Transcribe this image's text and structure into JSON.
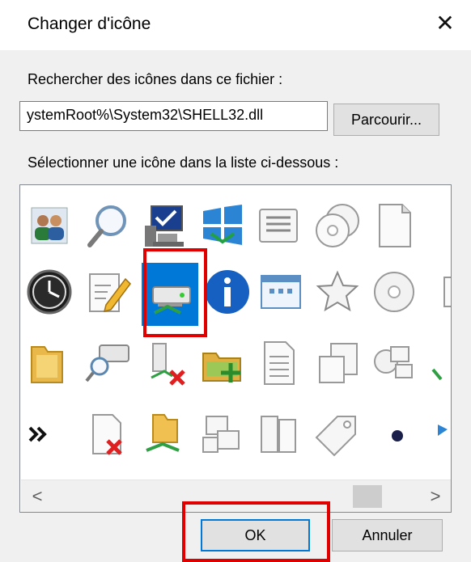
{
  "dialog": {
    "title": "Changer d'icône",
    "close_symbol": "✕"
  },
  "search": {
    "label": "Rechercher des icônes dans ce fichier :",
    "path_value": "ystemRoot%\\System32\\SHELL32.dll",
    "browse_label": "Parcourir..."
  },
  "list": {
    "label": "Sélectionner une icône dans la liste ci-dessous :",
    "icons": [
      "users-icon",
      "search-magnifier-icon",
      "computer-monitor-icon",
      "windows-logo-icon",
      "document-lines-icon",
      "disc-stack-icon",
      "blank-page-icon",
      "clock-icon",
      "notepad-pencil-icon",
      "drive-network-icon",
      "info-icon",
      "window-grid-icon",
      "star-icon",
      "cd-disc-icon",
      "folder-icon",
      "scanner-icon",
      "drive-error-icon",
      "folder-add-icon",
      "text-page-icon",
      "window-stack-icon",
      "network-computers-icon",
      "double-chevron-icon",
      "page-error-icon",
      "folder-share-icon",
      "network-group-icon",
      "panels-icon",
      "tag-icon",
      "dot-icon"
    ],
    "selected_index": 9,
    "scroll_left_symbol": "<",
    "scroll_right_symbol": ">"
  },
  "buttons": {
    "ok_label": "OK",
    "cancel_label": "Annuler"
  },
  "colors": {
    "selection": "#0078d7",
    "annotation": "#e00000",
    "dialog_bg": "#f0f0f0"
  }
}
